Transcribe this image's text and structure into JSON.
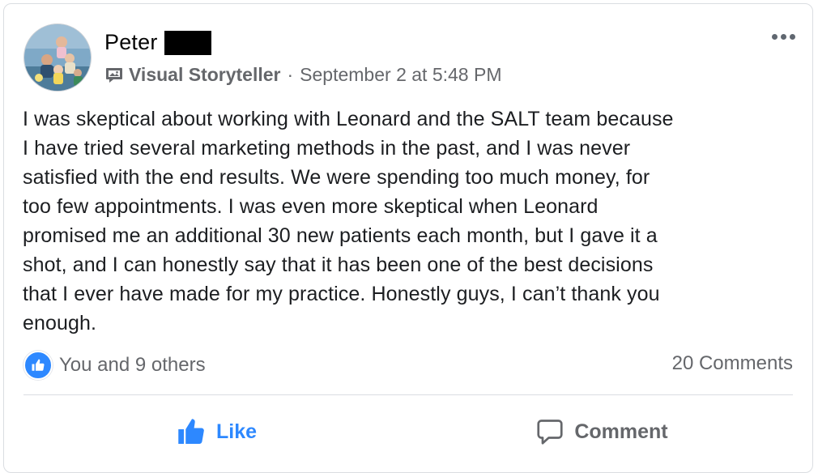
{
  "post": {
    "author": {
      "name": "Peter",
      "badge_icon": "storyteller-badge-icon",
      "badge_label": "Visual Storyteller"
    },
    "separator": "·",
    "timestamp": "September 2 at 5:48 PM",
    "more_icon": "more-options-icon",
    "text": "I was skeptical about working with Leonard and the SALT team because\nI have tried several marketing methods in the past, and I was never\nsatisfied with the end results. We were spending too much money, for\ntoo few appointments. I was even more skeptical when Leonard\npromised me an additional 30 new patients each month, but I gave it a\nshot, and I can honestly say that it has been one of the best decisions\nthat I ever have made for my practice. Honestly guys, I can’t thank you\nenough.",
    "reactions_label": "You and 9 others",
    "comments_label": "20 Comments"
  },
  "actions": {
    "like_label": "Like",
    "comment_label": "Comment"
  },
  "colors": {
    "accent": "#2d88ff",
    "secondary_text": "#65676b",
    "divider": "#dadde1"
  }
}
